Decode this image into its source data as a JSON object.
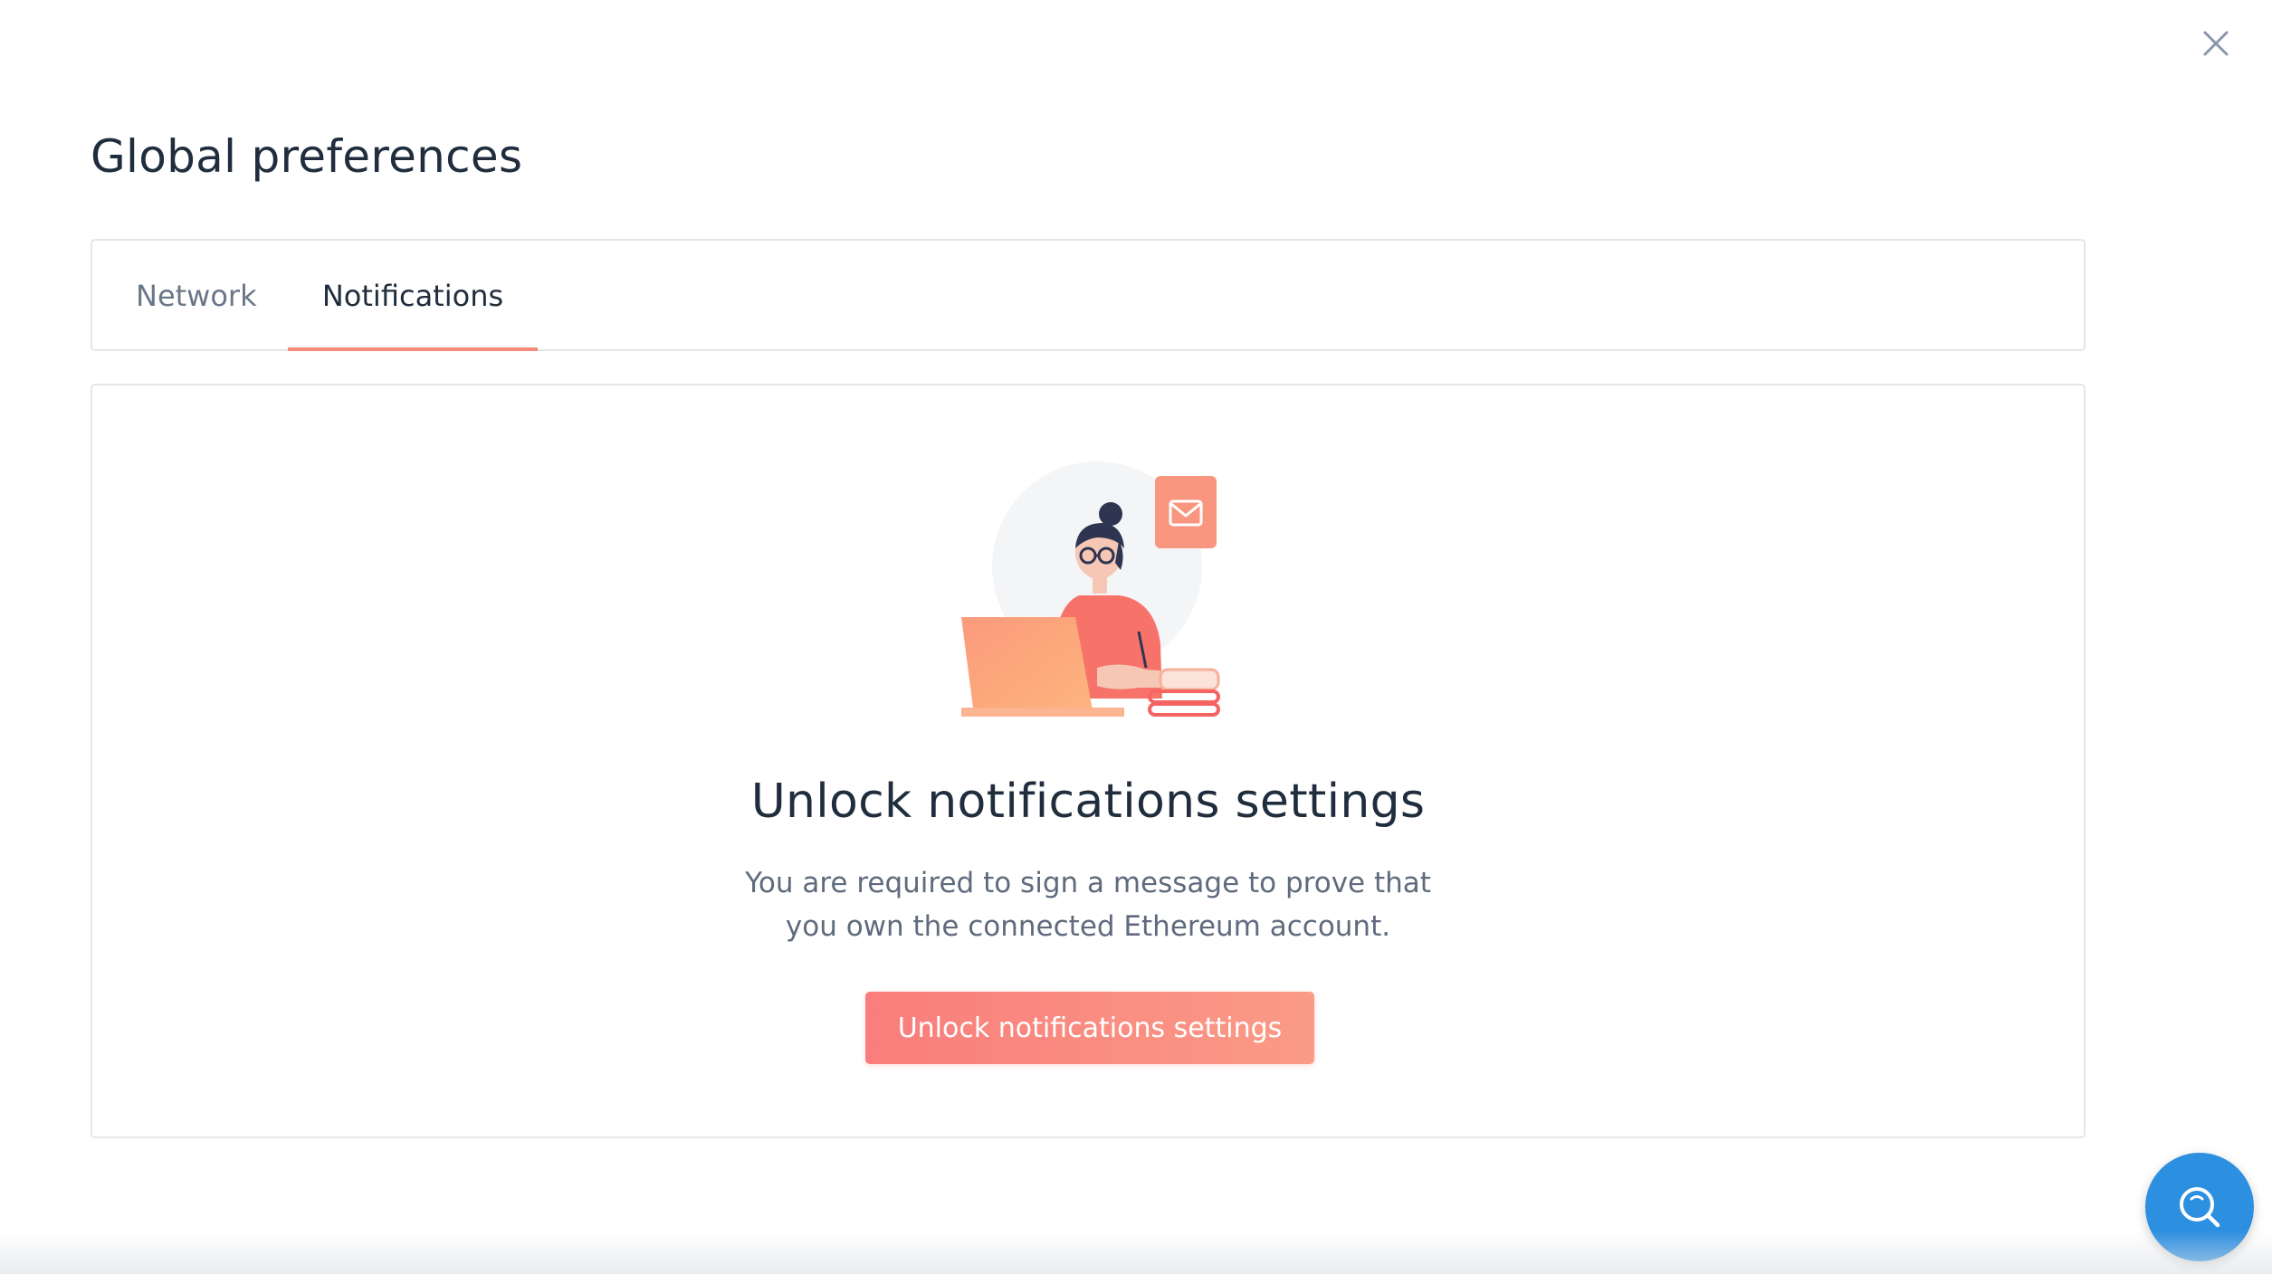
{
  "dialog": {
    "title": "Global preferences",
    "close_icon": "close-icon"
  },
  "tabs": [
    {
      "label": "Network",
      "active": false
    },
    {
      "label": "Notifications",
      "active": true
    }
  ],
  "notifications_panel": {
    "illustration": "person-at-laptop-with-mail-illustration",
    "heading": "Unlock notifications settings",
    "description": "You are required to sign a message to prove that you own the connected Ethereum account.",
    "button_label": "Unlock notifications settings"
  },
  "help_button": {
    "icon": "search-chat-icon"
  },
  "colors": {
    "accent": "#f97d7c",
    "accent_light": "#fa9b86",
    "tab_underline": "#f58a7a",
    "help_button": "#2d8fe0",
    "text_primary": "#1f2d3d",
    "text_secondary": "#5f6b7d",
    "border": "#e3e6ea"
  }
}
